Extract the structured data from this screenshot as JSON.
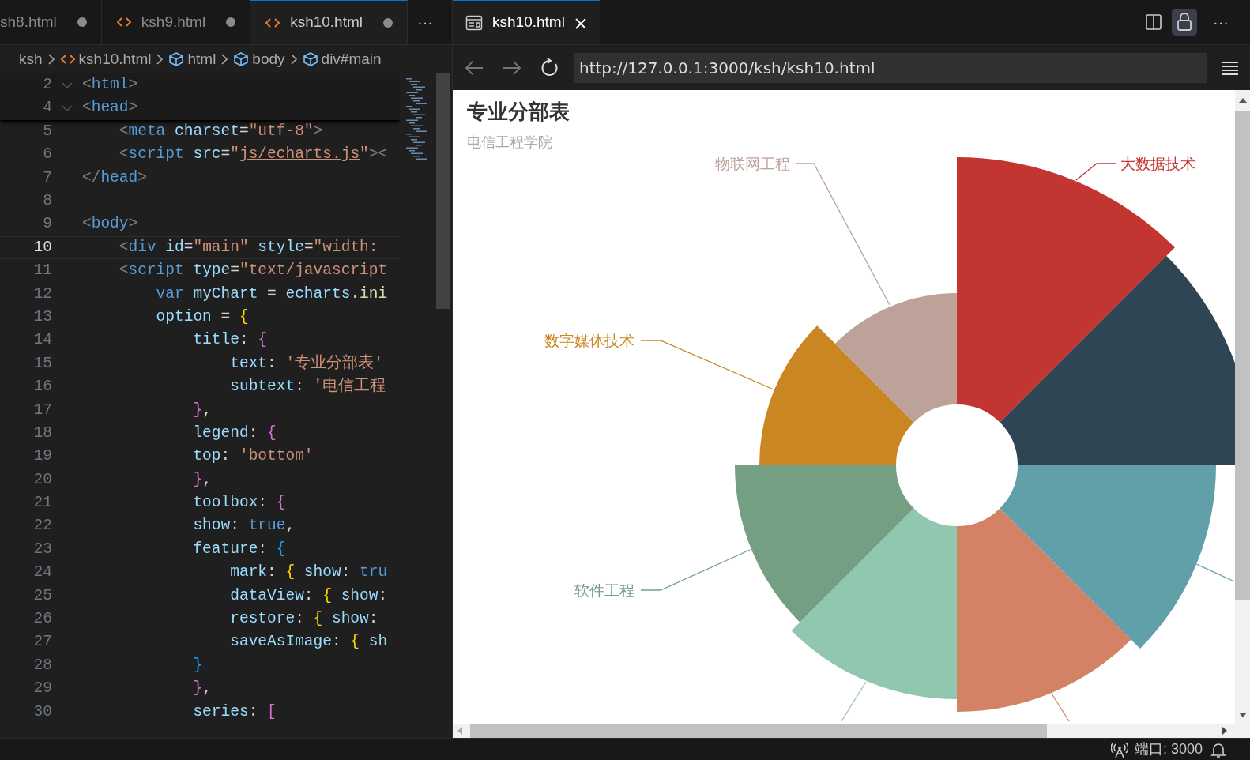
{
  "editor_tabs": [
    {
      "label": "sh8.html",
      "icon": false,
      "selected": false,
      "modified": true
    },
    {
      "label": "ksh9.html",
      "icon": true,
      "selected": false,
      "modified": true
    },
    {
      "label": "ksh10.html",
      "icon": true,
      "selected": true,
      "modified": true
    }
  ],
  "more_tabs": "···",
  "breadcrumbs": [
    {
      "label": "ksh",
      "kind": "folder"
    },
    {
      "label": "ksh10.html",
      "kind": "file"
    },
    {
      "label": "html",
      "kind": "element"
    },
    {
      "label": "body",
      "kind": "element"
    },
    {
      "label": "div#main",
      "kind": "element"
    }
  ],
  "sticky_lines": [
    {
      "number": "2",
      "fold": true,
      "current": false,
      "tokens": [
        {
          "kind": "p",
          "text": "<"
        },
        {
          "kind": "tag",
          "text": "html"
        },
        {
          "kind": "p",
          "text": ">"
        }
      ]
    },
    {
      "number": "4",
      "fold": true,
      "current": false,
      "tokens": [
        {
          "kind": "p",
          "text": "<"
        },
        {
          "kind": "tag",
          "text": "head"
        },
        {
          "kind": "p",
          "text": ">"
        }
      ]
    }
  ],
  "code_lines": [
    {
      "number": "5",
      "fold": false,
      "current": false,
      "tokens": [
        {
          "kind": "p",
          "text": "    <"
        },
        {
          "kind": "tag",
          "text": "meta"
        },
        {
          "kind": "attr",
          "text": " charset"
        },
        {
          "kind": "op",
          "text": "="
        },
        {
          "kind": "str",
          "text": "\"utf-8\""
        },
        {
          "kind": "p",
          "text": ">"
        }
      ]
    },
    {
      "number": "6",
      "fold": false,
      "current": false,
      "tokens": [
        {
          "kind": "p",
          "text": "    <"
        },
        {
          "kind": "tag",
          "text": "script"
        },
        {
          "kind": "attr",
          "text": " src"
        },
        {
          "kind": "op",
          "text": "="
        },
        {
          "kind": "str",
          "text": "\""
        },
        {
          "kind": "link",
          "text": "js/echarts.js"
        },
        {
          "kind": "str",
          "text": "\""
        },
        {
          "kind": "p",
          "text": "><"
        }
      ]
    },
    {
      "number": "7",
      "fold": false,
      "current": false,
      "tokens": [
        {
          "kind": "p",
          "text": "</"
        },
        {
          "kind": "tag",
          "text": "head"
        },
        {
          "kind": "p",
          "text": ">"
        }
      ]
    },
    {
      "number": "8",
      "fold": false,
      "current": false
    },
    {
      "number": "9",
      "fold": false,
      "current": false,
      "tokens": [
        {
          "kind": "p",
          "text": "<"
        },
        {
          "kind": "tag",
          "text": "body"
        },
        {
          "kind": "p",
          "text": ">"
        }
      ]
    },
    {
      "number": "10",
      "fold": false,
      "current": true,
      "tokens": [
        {
          "kind": "p",
          "text": "    <"
        },
        {
          "kind": "tag",
          "text": "div"
        },
        {
          "kind": "attr",
          "text": " id"
        },
        {
          "kind": "op",
          "text": "="
        },
        {
          "kind": "str",
          "text": "\"main\""
        },
        {
          "kind": "attr",
          "text": " style"
        },
        {
          "kind": "op",
          "text": "="
        },
        {
          "kind": "str",
          "text": "\"width:"
        }
      ]
    },
    {
      "number": "11",
      "fold": false,
      "current": false,
      "tokens": [
        {
          "kind": "p",
          "text": "    <"
        },
        {
          "kind": "tag",
          "text": "script"
        },
        {
          "kind": "attr",
          "text": " type"
        },
        {
          "kind": "op",
          "text": "="
        },
        {
          "kind": "str",
          "text": "\"text/javascript"
        }
      ]
    },
    {
      "number": "12",
      "fold": false,
      "current": false,
      "tokens": [
        {
          "kind": "kw",
          "text": "        var"
        },
        {
          "kind": "var",
          "text": " myChart"
        },
        {
          "kind": "op",
          "text": " = "
        },
        {
          "kind": "var",
          "text": "echarts"
        },
        {
          "kind": "op",
          "text": "."
        },
        {
          "kind": "fn",
          "text": "ini"
        }
      ]
    },
    {
      "number": "13",
      "fold": false,
      "current": false,
      "tokens": [
        {
          "kind": "var",
          "text": "        option"
        },
        {
          "kind": "op",
          "text": " = "
        },
        {
          "kind": "b1",
          "text": "{"
        }
      ]
    },
    {
      "number": "14",
      "fold": false,
      "current": false,
      "tokens": [
        {
          "kind": "var",
          "text": "            title"
        },
        {
          "kind": "op",
          "text": ": "
        },
        {
          "kind": "b2",
          "text": "{"
        }
      ]
    },
    {
      "number": "15",
      "fold": false,
      "current": false,
      "tokens": [
        {
          "kind": "var",
          "text": "                text"
        },
        {
          "kind": "op",
          "text": ": "
        },
        {
          "kind": "str",
          "text": "'专业分部表'"
        }
      ]
    },
    {
      "number": "16",
      "fold": false,
      "current": false,
      "tokens": [
        {
          "kind": "var",
          "text": "                subtext"
        },
        {
          "kind": "op",
          "text": ": "
        },
        {
          "kind": "str",
          "text": "'电信工程"
        }
      ]
    },
    {
      "number": "17",
      "fold": false,
      "current": false,
      "tokens": [
        {
          "kind": "b2",
          "text": "            }"
        },
        {
          "kind": "op",
          "text": ","
        }
      ]
    },
    {
      "number": "18",
      "fold": false,
      "current": false,
      "tokens": [
        {
          "kind": "var",
          "text": "            legend"
        },
        {
          "kind": "op",
          "text": ": "
        },
        {
          "kind": "b2",
          "text": "{"
        }
      ]
    },
    {
      "number": "19",
      "fold": false,
      "current": false,
      "tokens": [
        {
          "kind": "var",
          "text": "            top"
        },
        {
          "kind": "op",
          "text": ": "
        },
        {
          "kind": "str",
          "text": "'bottom'"
        }
      ]
    },
    {
      "number": "20",
      "fold": false,
      "current": false,
      "tokens": [
        {
          "kind": "b2",
          "text": "            }"
        },
        {
          "kind": "op",
          "text": ","
        }
      ]
    },
    {
      "number": "21",
      "fold": false,
      "current": false,
      "tokens": [
        {
          "kind": "var",
          "text": "            toolbox"
        },
        {
          "kind": "op",
          "text": ": "
        },
        {
          "kind": "b2",
          "text": "{"
        }
      ]
    },
    {
      "number": "22",
      "fold": false,
      "current": false,
      "tokens": [
        {
          "kind": "var",
          "text": "            show"
        },
        {
          "kind": "op",
          "text": ": "
        },
        {
          "kind": "kw",
          "text": "true"
        },
        {
          "kind": "op",
          "text": ","
        }
      ]
    },
    {
      "number": "23",
      "fold": false,
      "current": false,
      "tokens": [
        {
          "kind": "var",
          "text": "            feature"
        },
        {
          "kind": "op",
          "text": ": "
        },
        {
          "kind": "b3",
          "text": "{"
        }
      ]
    },
    {
      "number": "24",
      "fold": false,
      "current": false,
      "tokens": [
        {
          "kind": "var",
          "text": "                mark"
        },
        {
          "kind": "op",
          "text": ": "
        },
        {
          "kind": "b1",
          "text": "{"
        },
        {
          "kind": "var",
          "text": " show"
        },
        {
          "kind": "op",
          "text": ": "
        },
        {
          "kind": "kw",
          "text": "tru"
        }
      ]
    },
    {
      "number": "25",
      "fold": false,
      "current": false,
      "tokens": [
        {
          "kind": "var",
          "text": "                dataView"
        },
        {
          "kind": "op",
          "text": ": "
        },
        {
          "kind": "b1",
          "text": "{"
        },
        {
          "kind": "var",
          "text": " show"
        },
        {
          "kind": "op",
          "text": ":"
        }
      ]
    },
    {
      "number": "26",
      "fold": false,
      "current": false,
      "tokens": [
        {
          "kind": "var",
          "text": "                restore"
        },
        {
          "kind": "op",
          "text": ": "
        },
        {
          "kind": "b1",
          "text": "{"
        },
        {
          "kind": "var",
          "text": " show"
        },
        {
          "kind": "op",
          "text": ":"
        }
      ]
    },
    {
      "number": "27",
      "fold": false,
      "current": false,
      "tokens": [
        {
          "kind": "var",
          "text": "                saveAsImage"
        },
        {
          "kind": "op",
          "text": ": "
        },
        {
          "kind": "b1",
          "text": "{"
        },
        {
          "kind": "var",
          "text": " sh"
        }
      ]
    },
    {
      "number": "28",
      "fold": false,
      "current": false,
      "tokens": [
        {
          "kind": "b3",
          "text": "            }"
        }
      ]
    },
    {
      "number": "29",
      "fold": false,
      "current": false,
      "tokens": [
        {
          "kind": "b2",
          "text": "            }"
        },
        {
          "kind": "op",
          "text": ","
        }
      ]
    },
    {
      "number": "30",
      "fold": false,
      "current": false,
      "tokens": [
        {
          "kind": "var",
          "text": "            series"
        },
        {
          "kind": "op",
          "text": ": "
        },
        {
          "kind": "b2",
          "text": "["
        }
      ]
    }
  ],
  "preview_tab": {
    "label": "ksh10.html",
    "selected": true
  },
  "browser": {
    "url": "http://127.0.0.1:3000/ksh/ksh10.html",
    "back_disabled": true,
    "forward_disabled": true
  },
  "chart": {
    "title": "专业分部表",
    "subtitle": "电信工程学院",
    "slices": [
      {
        "color": "#c23531",
        "label": "大数据技术"
      },
      {
        "color": "#2f4554"
      },
      {
        "color": "#61a0a8"
      },
      {
        "color": "#d48265"
      },
      {
        "color": "#91c7ae"
      },
      {
        "color": "#749f83",
        "label": "软件工程"
      },
      {
        "color": "#ca8622",
        "label": "数字媒体技术"
      },
      {
        "color": "#bda29a",
        "label": "物联网工程"
      }
    ]
  },
  "status_bar": {
    "ports": "端口: 3000"
  }
}
